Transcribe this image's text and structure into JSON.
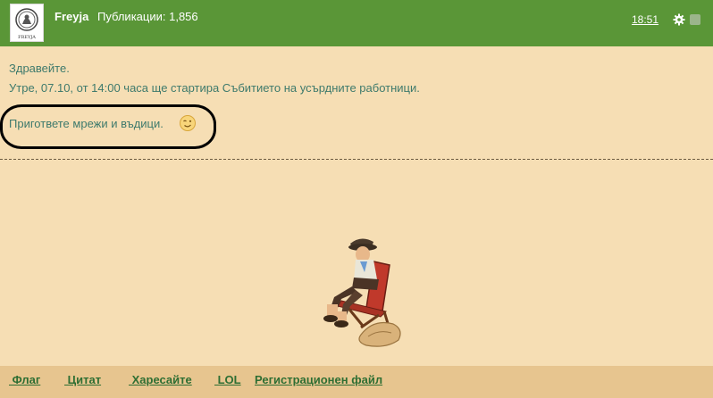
{
  "header": {
    "author": "Freyja",
    "posts_label": "Публикации:",
    "posts_count": "1,856",
    "time": "18:51",
    "avatar_caption": "FREYJA",
    "icons": [
      "gear-icon",
      "square-icon"
    ],
    "color": "#5a9637"
  },
  "message": {
    "greeting": "Здравейте.",
    "event_line": "Утре, 07.10, от 14:00 часа ще стартира Събитието на усърдните работници.",
    "prepare_line": "Пригответе мрежи и въдици.",
    "emoji": "wink-icon",
    "text_color": "#3e7a6c"
  },
  "footer": {
    "links": [
      " Флаг",
      " Цитат",
      " Харесайте",
      " LOL",
      "Регистрационен файл"
    ]
  }
}
